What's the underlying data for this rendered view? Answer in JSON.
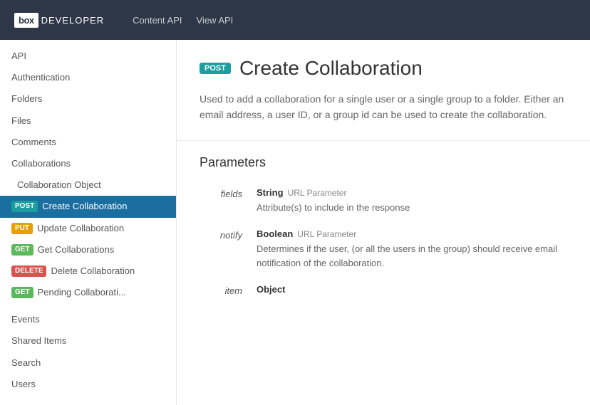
{
  "header": {
    "logo_box": "box",
    "logo_dev": "DEVELOPER",
    "nav_items": [
      "Content API",
      "View API"
    ]
  },
  "sidebar": {
    "items": [
      {
        "id": "api",
        "label": "API",
        "indent": "none",
        "badge": null
      },
      {
        "id": "authentication",
        "label": "Authentication",
        "indent": "none",
        "badge": null
      },
      {
        "id": "folders",
        "label": "Folders",
        "indent": "none",
        "badge": null
      },
      {
        "id": "files",
        "label": "Files",
        "indent": "none",
        "badge": null
      },
      {
        "id": "comments",
        "label": "Comments",
        "indent": "none",
        "badge": null
      },
      {
        "id": "collaborations",
        "label": "Collaborations",
        "indent": "none",
        "badge": null
      },
      {
        "id": "collaboration-object",
        "label": "Collaboration Object",
        "indent": "indented",
        "badge": null
      },
      {
        "id": "create-collaboration",
        "label": "Create Collaboration",
        "indent": "sub-indented",
        "badge": "POST",
        "badge_type": "post",
        "active": true
      },
      {
        "id": "update-collaboration",
        "label": "Update Collaboration",
        "indent": "sub-indented",
        "badge": "PUT",
        "badge_type": "put"
      },
      {
        "id": "get-collaborations",
        "label": "Get Collaborations",
        "indent": "sub-indented",
        "badge": "GET",
        "badge_type": "get"
      },
      {
        "id": "delete-collaboration",
        "label": "Delete Collaboration",
        "indent": "sub-indented",
        "badge": "DELETE",
        "badge_type": "delete"
      },
      {
        "id": "pending-collaborations",
        "label": "Pending Collaborati...",
        "indent": "sub-indented",
        "badge": "GET",
        "badge_type": "get"
      },
      {
        "id": "events",
        "label": "Events",
        "indent": "none",
        "badge": null
      },
      {
        "id": "shared-items",
        "label": "Shared Items",
        "indent": "none",
        "badge": null
      },
      {
        "id": "search",
        "label": "Search",
        "indent": "none",
        "badge": null
      },
      {
        "id": "users",
        "label": "Users",
        "indent": "none",
        "badge": null
      }
    ]
  },
  "main": {
    "badge_label": "POST",
    "title": "Create Collaboration",
    "description": "Used to add a collaboration for a single user or a single group to a folder. Either an email address, a user ID, or a group id can be used to create the collaboration.",
    "params_title": "Parameters",
    "params": [
      {
        "name": "fields",
        "type_name": "String",
        "type_kind": "URL Parameter",
        "description": "Attribute(s) to include in the response"
      },
      {
        "name": "notify",
        "type_name": "Boolean",
        "type_kind": "URL Parameter",
        "description": "Determines if the user, (or all the users in the group) should receive email notification of the collaboration."
      },
      {
        "name": "item",
        "type_name": "Object",
        "type_kind": "",
        "description": ""
      }
    ]
  }
}
